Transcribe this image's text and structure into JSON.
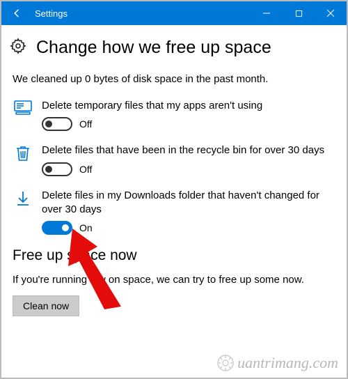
{
  "titlebar": {
    "app_name": "Settings"
  },
  "heading": "Change how we free up space",
  "summary": "We cleaned up 0 bytes of disk space in the past month.",
  "settings": [
    {
      "label": "Delete temporary files that my apps aren't using",
      "state_text": "Off",
      "on": false
    },
    {
      "label": "Delete files that have been in the recycle bin for over 30 days",
      "state_text": "Off",
      "on": false
    },
    {
      "label": "Delete files in my Downloads folder that haven't changed for over 30 days",
      "state_text": "On",
      "on": true
    }
  ],
  "free_up": {
    "heading": "Free up space now",
    "text": "If you're running low on space, we can try to free up some now.",
    "button": "Clean now"
  },
  "watermark": "uantrimang.com"
}
